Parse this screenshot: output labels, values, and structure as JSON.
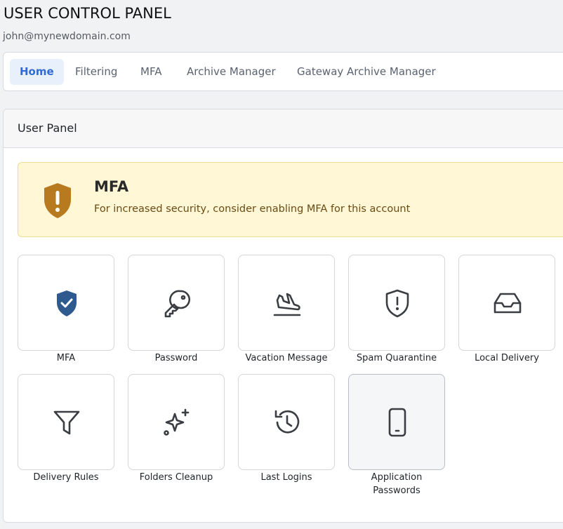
{
  "header": {
    "title": "USER CONTROL PANEL",
    "email": "john@mynewdomain.com"
  },
  "nav": {
    "tabs": [
      {
        "label": "Home",
        "active": true
      },
      {
        "label": "Filtering"
      },
      {
        "label": "MFA"
      },
      {
        "label": "Archive Manager"
      },
      {
        "label": "Gateway Archive Manager"
      }
    ]
  },
  "panel": {
    "title": "User Panel"
  },
  "alert": {
    "title": "MFA",
    "text": "For increased security, consider enabling MFA for this account",
    "icon": "shield-exclamation-icon",
    "color": "#b87a1e"
  },
  "tiles": [
    {
      "label": "MFA",
      "icon": "shield-check-icon"
    },
    {
      "label": "Password",
      "icon": "key-icon"
    },
    {
      "label": "Vacation Message",
      "icon": "plane-landing-icon"
    },
    {
      "label": "Spam Quarantine",
      "icon": "shield-alert-icon"
    },
    {
      "label": "Local Delivery",
      "icon": "inbox-icon"
    },
    {
      "label": "Delivery Rules",
      "icon": "filter-icon"
    },
    {
      "label": "Folders Cleanup",
      "icon": "sparkles-icon"
    },
    {
      "label": "Last Logins",
      "icon": "history-icon"
    },
    {
      "label": "Application Passwords",
      "icon": "mobile-device-icon"
    }
  ],
  "colors": {
    "accent": "#2f6bd1",
    "mfa_icon": "#2e5a8e",
    "icon_stroke": "#3a3d42"
  }
}
